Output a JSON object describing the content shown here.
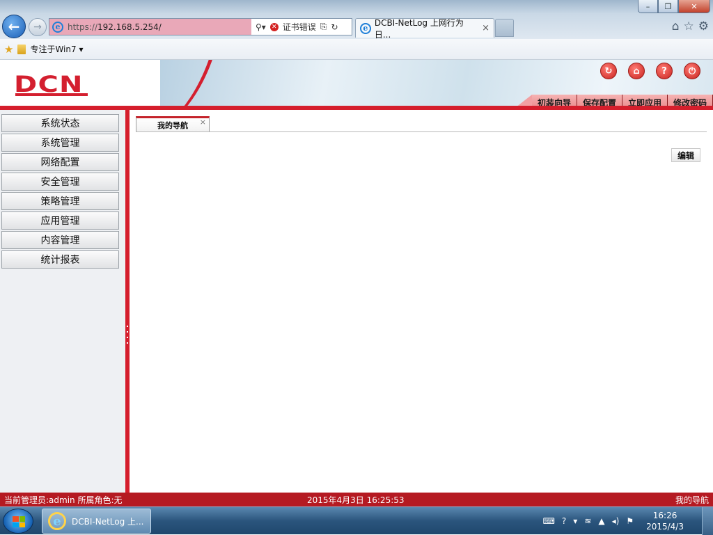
{
  "browser": {
    "address_url_prefix": "https://",
    "address_url_host": "192.168.5.254/",
    "cert_error_label": "证书错误",
    "tab_title": "DCBI-NetLog 上网行为日...",
    "tab_close": "×",
    "favorites_item": "专注于Win7 ▾",
    "window_buttons": {
      "minimize": "–",
      "restore": "❐",
      "close": "✕"
    }
  },
  "header": {
    "logo_text": "DCN",
    "icons": [
      "refresh-icon",
      "home-icon",
      "help-icon",
      "logout-icon"
    ],
    "topnav": [
      "初装向导",
      "保存配置",
      "立即应用",
      "修改密码"
    ]
  },
  "sidebar": {
    "items": [
      "系统状态",
      "系统管理",
      "网络配置",
      "安全管理",
      "策略管理",
      "应用管理",
      "内容管理",
      "统计报表"
    ]
  },
  "main": {
    "tab_label": "我的导航",
    "tab_close": "×",
    "edit_button": "编辑"
  },
  "status": {
    "admin_info": "当前管理员:admin   所属角色:无",
    "datetime": "2015年4月3日  16:25:53",
    "breadcrumb": "我的导航"
  },
  "taskbar": {
    "item_label": "DCBI-NetLog 上...",
    "clock_time": "16:26",
    "clock_date": "2015/4/3"
  },
  "colors": {
    "brand_red": "#d41f2f",
    "statusbar": "#b51a22"
  }
}
